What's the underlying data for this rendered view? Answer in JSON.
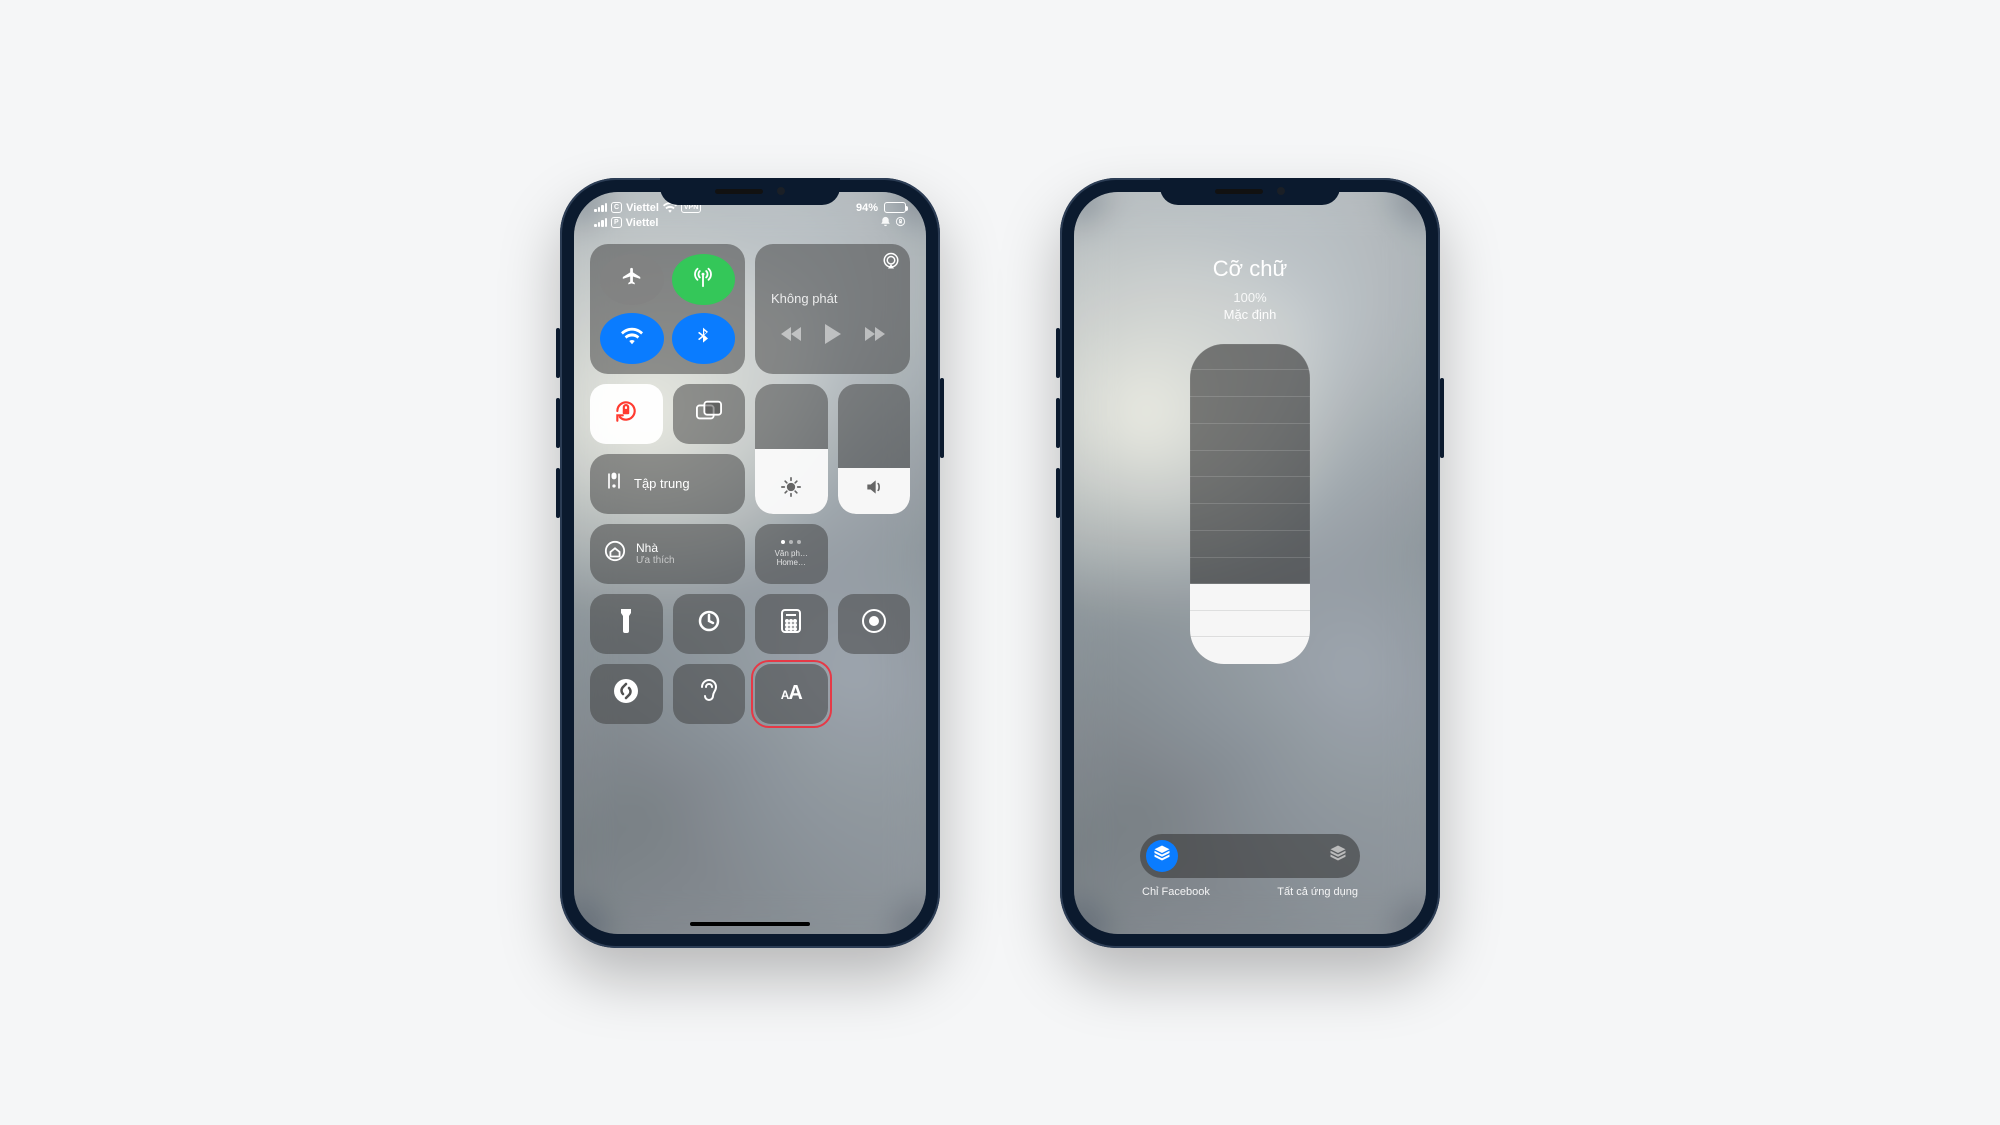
{
  "status": {
    "carrier1_badge": "C",
    "carrier1_name": "Viettel",
    "carrier2_badge": "P",
    "carrier2_name": "Viettel",
    "vpn_label": "VPN",
    "battery_text": "94%",
    "battery_fill_pct": 94
  },
  "control_center": {
    "media_title": "Không phát",
    "focus_label": "Tập trung",
    "home_title": "Nhà",
    "home_subtitle": "Ưa thích",
    "scene_label": "Văn ph…\nHome…",
    "brightness_pct": 50,
    "volume_pct": 35,
    "text_size_label_small": "A",
    "text_size_label_big": "A"
  },
  "text_size": {
    "title": "Cỡ chữ",
    "percent": "100%",
    "default_label": "Mặc định",
    "slider_steps": 12,
    "slider_value_step_from_bottom": 3,
    "scope_only_label": "Chỉ Facebook",
    "scope_all_label": "Tất cả ứng dụng"
  }
}
